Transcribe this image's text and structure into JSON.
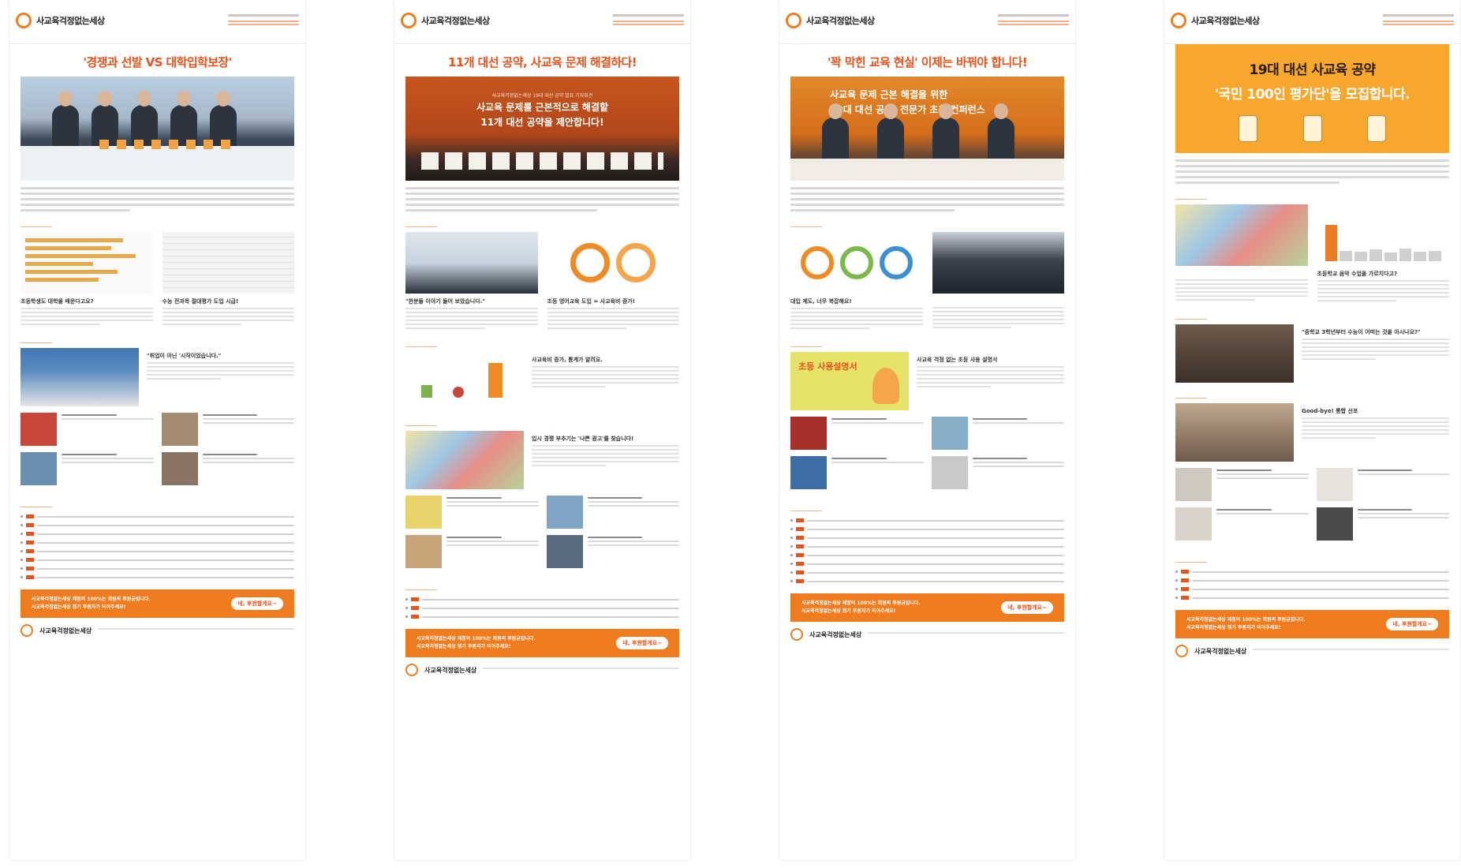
{
  "org_name": "사교육걱정없는세상",
  "pages": [
    {
      "headline": "'경쟁과 선발 VS 대학입학보장'",
      "captions": [
        "초등학생도 대학을 배운다고요?",
        "수능 전과목 절대평가 도입 시급!",
        "\"취업이 아닌 '시작이었습니다.\""
      ],
      "support_btn": "네, 후원할게요~",
      "support_text": [
        "사교육걱정없는세상 재정의 100%는 회원의 후원금입니다.",
        "사교육걱정없는세상 정기 후원자가 되어주세요!"
      ]
    },
    {
      "headline": "11개 대선 공약, 사교육 문제 해결하다!",
      "hero_small": "사교육걱정없는세상 19대 대선 공약 발표 기자회견",
      "hero_line1": "사교육 문제를 근본적으로 해결할",
      "hero_line2": "11개 대선 공약을 제안합니다!",
      "captions": [
        "\"한분들 이야기 들어 보았습니다.\"",
        "초등 영어교육 도입 = 사교육비 증가!",
        "사교육비 증가, 통계가 알려요.",
        "입시 경쟁 부추기는 '나쁜 광고'를 찾습니다!"
      ],
      "support_btn": "네, 후원할게요~",
      "support_text": [
        "사교육걱정없는세상 재정의 100%는 회원의 후원금입니다.",
        "사교육걱정없는세상 정기 후원자가 되어주세요!"
      ]
    },
    {
      "headline": "'꽉 막힌 교육 현실' 이제는 바꿔야 합니다!",
      "hero_line1": "사교육 문제 근본 해결을 위한",
      "hero_line2": "19대 대선 공약, 전문가 초청 컨퍼런스",
      "captions": [
        "대입 제도, 너무 복잡해요!",
        "사교육 걱정 없는 초등 사용 설명서",
        "초등 사용설명서"
      ],
      "support_btn": "네, 후원할게요~",
      "support_text": [
        "사교육걱정없는세상 재정의 100%는 회원의 후원금입니다.",
        "사교육걱정없는세상 정기 후원자가 되어주세요!"
      ]
    },
    {
      "hero_line1": "19대 대선 사교육 공약",
      "hero_line2": "'국민 100인 평가단'을 모집합니다.",
      "captions": [
        "초등학교 음악 수업을 가르치다고?",
        "\"중학교 3학년부터 수능이 어떠는 것을 아시나요?\"",
        "Good-bye! 통합 선포"
      ],
      "support_btn": "네, 후원할게요~",
      "support_text": [
        "사교육걱정없는세상 재정의 100%는 회원의 후원금입니다.",
        "사교육걱정없는세상 정기 후원자가 되어주세요!"
      ]
    }
  ]
}
